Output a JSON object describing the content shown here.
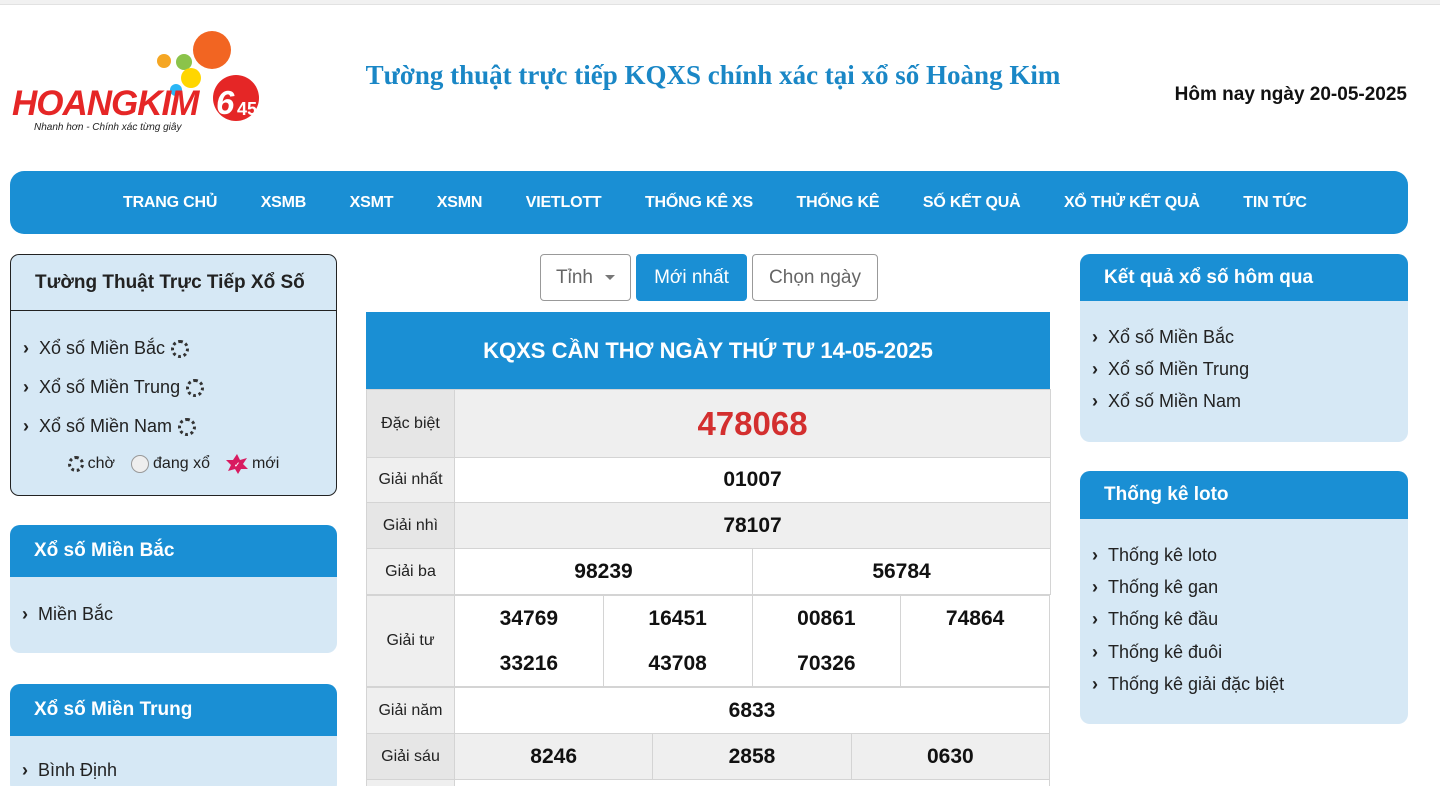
{
  "header": {
    "logo_text": "HOANGKIM",
    "logo_tagline": "Nhanh hơn - Chính xác từng giây",
    "logo_number": "645",
    "site_title": "Tường thuật trực tiếp KQXS chính xác tại xổ số Hoàng Kim",
    "today": "Hôm nay ngày 20-05-2025"
  },
  "nav": [
    "TRANG CHỦ",
    "XSMB",
    "XSMT",
    "XSMN",
    "VIETLOTT",
    "THỐNG KÊ XS",
    "THỐNG KÊ",
    "SỐ KẾT QUẢ",
    "XỔ THỬ KẾT QUẢ",
    "TIN TỨC"
  ],
  "live": {
    "title": "Tường Thuật Trực Tiếp Xổ Số",
    "items": [
      "Xổ số Miền Bắc",
      "Xổ số Miền Trung",
      "Xổ số Miền Nam"
    ],
    "legend": {
      "wait": "chờ",
      "drawing": "đang xổ",
      "new": "mới"
    }
  },
  "left_cards": {
    "mb": {
      "title": "Xổ số Miền Bắc",
      "items": [
        "Miền Bắc"
      ]
    },
    "mt": {
      "title": "Xổ số Miền Trung",
      "items": [
        "Bình Định"
      ]
    }
  },
  "right_cards": {
    "yesterday": {
      "title": "Kết quả xổ số hôm qua",
      "items": [
        "Xổ số Miền Bắc",
        "Xổ số Miền Trung",
        "Xổ số Miền Nam"
      ]
    },
    "loto": {
      "title": "Thống kê loto",
      "items": [
        "Thống kê loto",
        "Thống kê gan",
        "Thống kê đầu",
        "Thống kê đuôi",
        "Thống kê giải đặc biệt"
      ]
    }
  },
  "filters": {
    "province": "Tỉnh",
    "latest": "Mới nhất",
    "pick_date": "Chọn ngày"
  },
  "result": {
    "title": "KQXS CẦN THƠ NGÀY THỨ TƯ 14-05-2025",
    "prizes": {
      "special": {
        "label": "Đặc biệt",
        "values": [
          "478068"
        ]
      },
      "first": {
        "label": "Giải nhất",
        "values": [
          "01007"
        ]
      },
      "second": {
        "label": "Giải nhì",
        "values": [
          "78107"
        ]
      },
      "third": {
        "label": "Giải ba",
        "values": [
          "98239",
          "56784"
        ]
      },
      "fourth": {
        "label": "Giải tư",
        "values": [
          "34769",
          "16451",
          "00861",
          "74864",
          "33216",
          "43708",
          "70326"
        ]
      },
      "fifth": {
        "label": "Giải năm",
        "values": [
          "6833"
        ]
      },
      "sixth": {
        "label": "Giải sáu",
        "values": [
          "8246",
          "2858",
          "0630"
        ]
      }
    }
  },
  "colors": {
    "brand_blue": "#1a8fd4",
    "special_red": "#d32f2f",
    "panel_bg": "#d6e8f5"
  }
}
